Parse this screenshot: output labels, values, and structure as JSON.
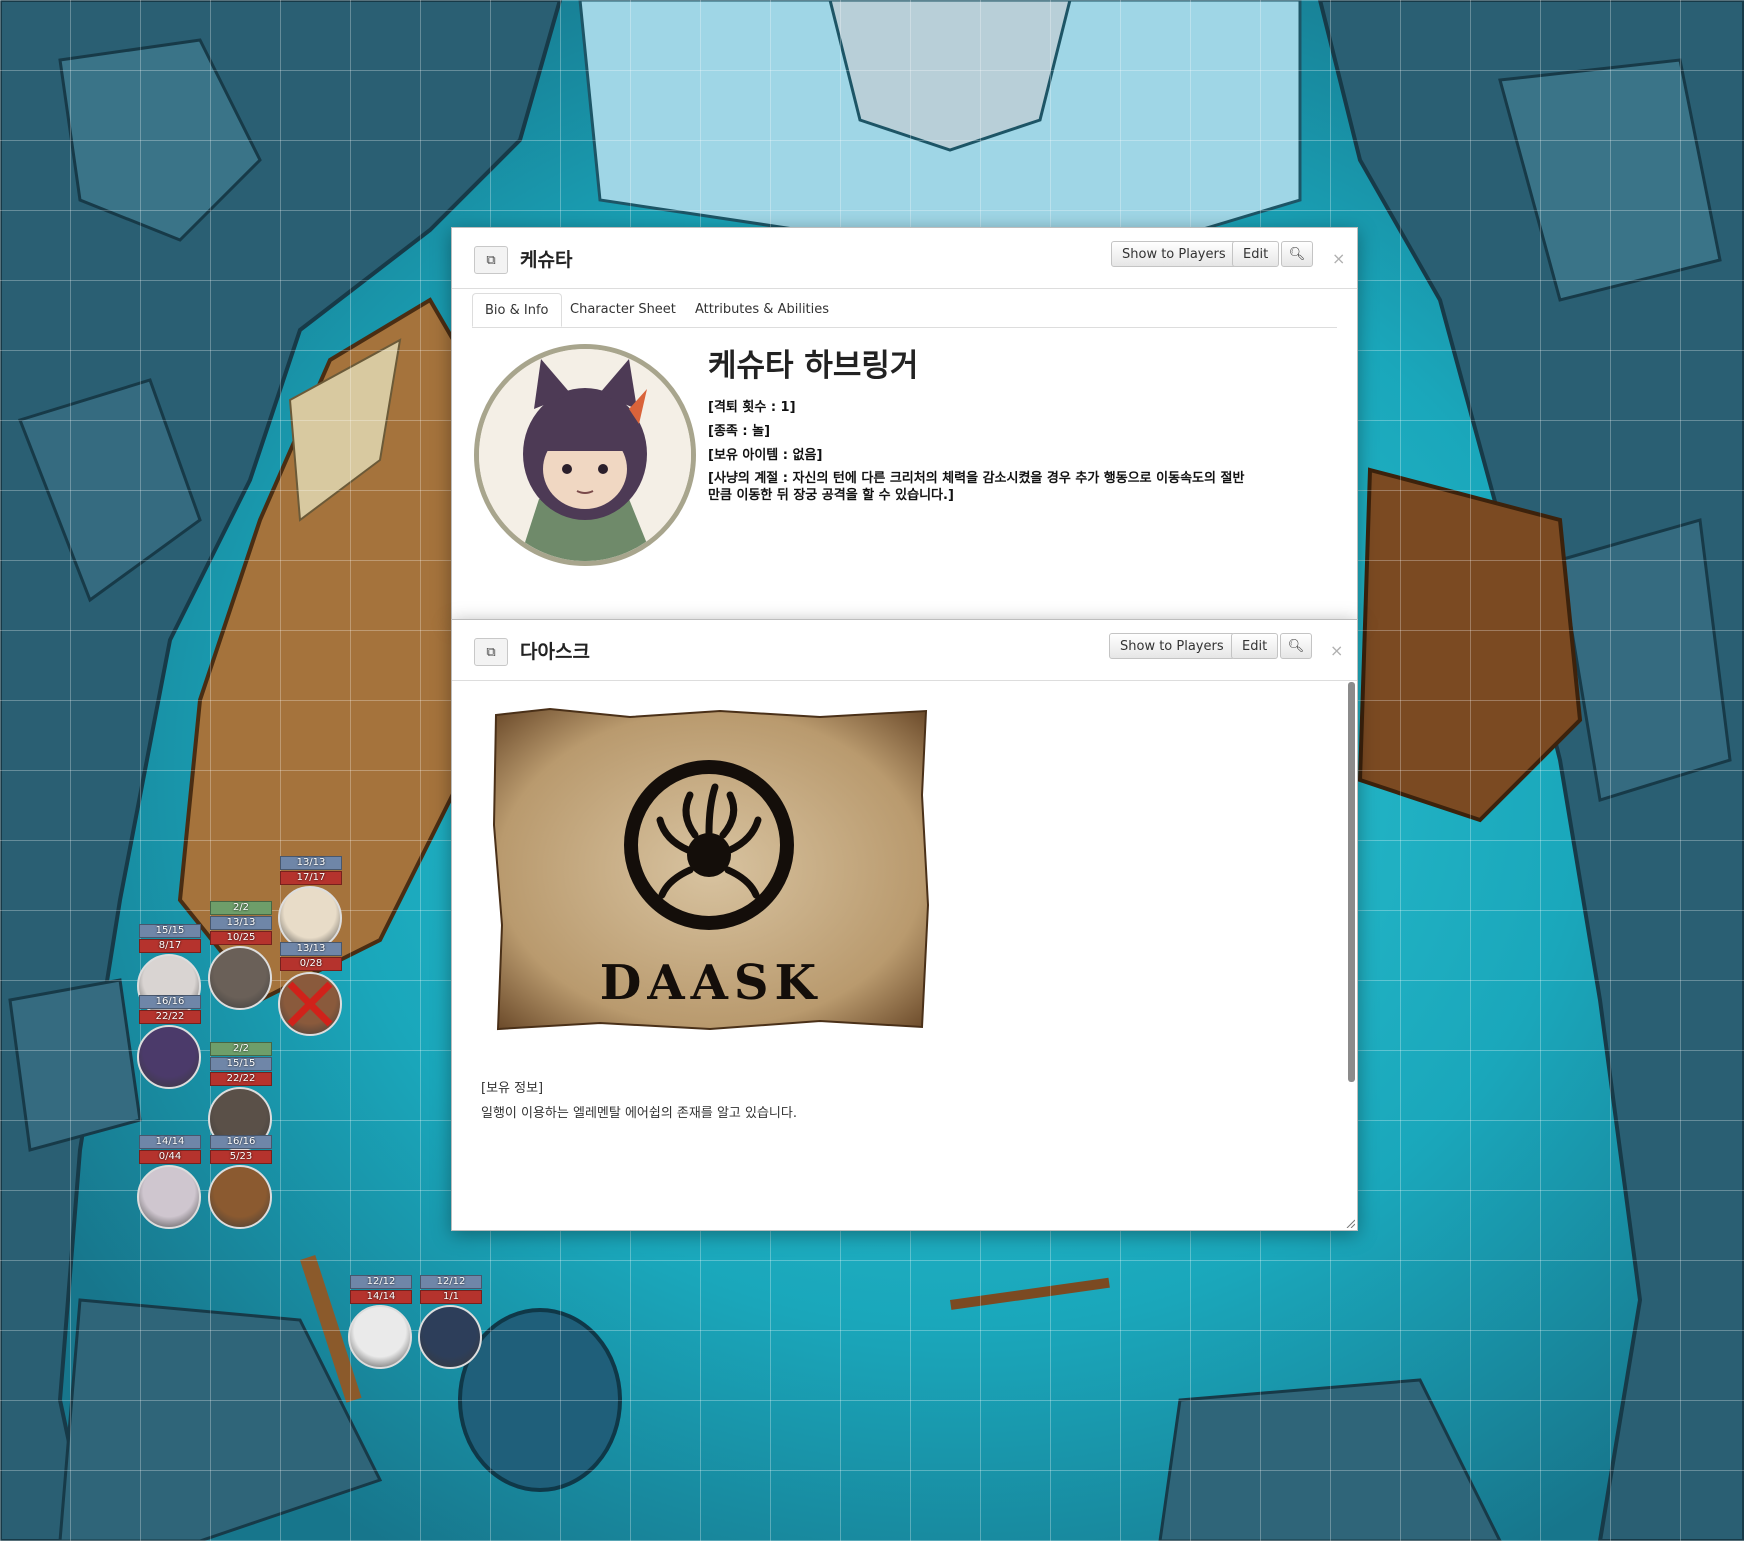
{
  "tokens": [
    {
      "bars": [
        "13/13",
        "17/17"
      ],
      "colors": [
        "blue",
        "red"
      ],
      "portrait_color": "#e8dcc8",
      "dead": false
    },
    {
      "bars": [
        "2/2",
        "13/13",
        "10/25"
      ],
      "colors": [
        "green",
        "blue",
        "red"
      ],
      "portrait_color": "#6a6058",
      "dead": false
    },
    {
      "bars": [
        "13/13",
        "0/28"
      ],
      "colors": [
        "blue",
        "red"
      ],
      "portrait_color": "#8a5a3c",
      "dead": true
    },
    {
      "bars": [
        "15/15",
        "8/17"
      ],
      "colors": [
        "blue",
        "red"
      ],
      "portrait_color": "#d9d4d2",
      "dead": false
    },
    {
      "bars": [
        "16/16",
        "22/22"
      ],
      "colors": [
        "blue",
        "red"
      ],
      "portrait_color": "#4b3a6a",
      "dead": false
    },
    {
      "bars": [
        "2/2",
        "15/15",
        "22/22"
      ],
      "colors": [
        "green",
        "blue",
        "red"
      ],
      "portrait_color": "#5a5048",
      "dead": false
    },
    {
      "bars": [
        "14/14",
        "0/44"
      ],
      "colors": [
        "blue",
        "red"
      ],
      "portrait_color": "#cfc6cf",
      "dead": false
    },
    {
      "bars": [
        "16/16",
        "5/23"
      ],
      "colors": [
        "blue",
        "red"
      ],
      "portrait_color": "#8b5a30",
      "dead": false
    },
    {
      "bars": [
        "12/12",
        "14/14"
      ],
      "colors": [
        "blue",
        "red"
      ],
      "portrait_color": "#eaeaea",
      "dead": false
    },
    {
      "bars": [
        "12/12",
        "1/1"
      ],
      "colors": [
        "blue",
        "red"
      ],
      "portrait_color": "#2d3e5a",
      "dead": false
    }
  ],
  "dialog1": {
    "title": "케슈타",
    "show_to_players": "Show to Players",
    "edit": "Edit",
    "tabs": [
      "Bio & Info",
      "Character Sheet",
      "Attributes & Abilities"
    ],
    "character_name": "케슈타 하브링거",
    "lines": [
      "[격퇴 횟수 : 1]",
      "[종족 : 놀]",
      "[보유 아이템 : 없음]"
    ],
    "paragraph": "[사냥의 계절 : 자신의 턴에 다른 크리처의 체력을 감소시켰을 경우 추가 행동으로 이동속도의 절반만큼 이동한 뒤 장궁 공격을 할 수 있습니다.]"
  },
  "dialog2": {
    "title": "다아스크",
    "show_to_players": "Show to Players",
    "edit": "Edit",
    "logo_text": "DAASK",
    "section_label": "[보유 정보]",
    "section_text": "일행이 이용하는 엘레멘탈 에어쉽의 존재를 알고 있습니다."
  },
  "colors": {
    "map_water": "#1b8fa3",
    "map_rock": "#2a5f73"
  }
}
